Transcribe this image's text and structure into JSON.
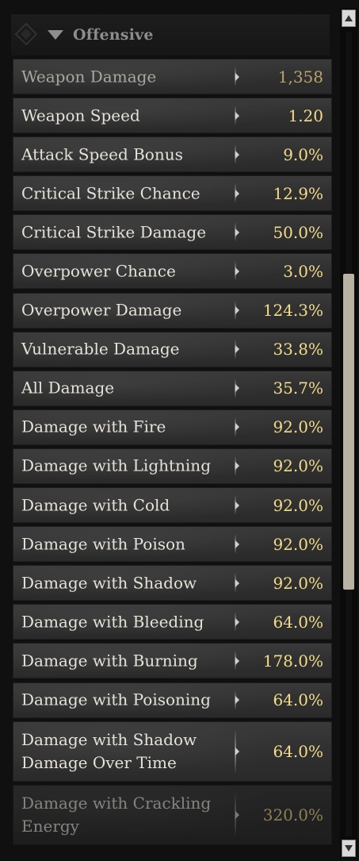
{
  "section": {
    "title": "Offensive"
  },
  "stats": [
    {
      "label": "Weapon Damage",
      "value": "1,358"
    },
    {
      "label": "Weapon Speed",
      "value": "1.20"
    },
    {
      "label": "Attack Speed Bonus",
      "value": "9.0%"
    },
    {
      "label": "Critical Strike Chance",
      "value": "12.9%"
    },
    {
      "label": "Critical Strike Damage",
      "value": "50.0%"
    },
    {
      "label": "Overpower Chance",
      "value": "3.0%"
    },
    {
      "label": "Overpower Damage",
      "value": "124.3%"
    },
    {
      "label": "Vulnerable Damage",
      "value": "33.8%"
    },
    {
      "label": "All Damage",
      "value": "35.7%"
    },
    {
      "label": "Damage with Fire",
      "value": "92.0%"
    },
    {
      "label": "Damage with Lightning",
      "value": "92.0%"
    },
    {
      "label": "Damage with Cold",
      "value": "92.0%"
    },
    {
      "label": "Damage with Poison",
      "value": "92.0%"
    },
    {
      "label": "Damage with Shadow",
      "value": "92.0%"
    },
    {
      "label": "Damage with Bleeding",
      "value": "64.0%"
    },
    {
      "label": "Damage with Burning",
      "value": "178.0%"
    },
    {
      "label": "Damage with Poisoning",
      "value": "64.0%"
    },
    {
      "label": "Damage with Shadow Damage Over Time",
      "value": "64.0%"
    },
    {
      "label": "Damage with Crackling Energy",
      "value": "320.0%"
    }
  ],
  "colors": {
    "value_gold": "#f2dc8a",
    "label_text": "#e6e2da",
    "row_bg": "#333333"
  },
  "icons": {
    "collapse": "triangle-down-icon",
    "scroll_up": "arrow-up-icon",
    "scroll_down": "arrow-down-icon"
  }
}
